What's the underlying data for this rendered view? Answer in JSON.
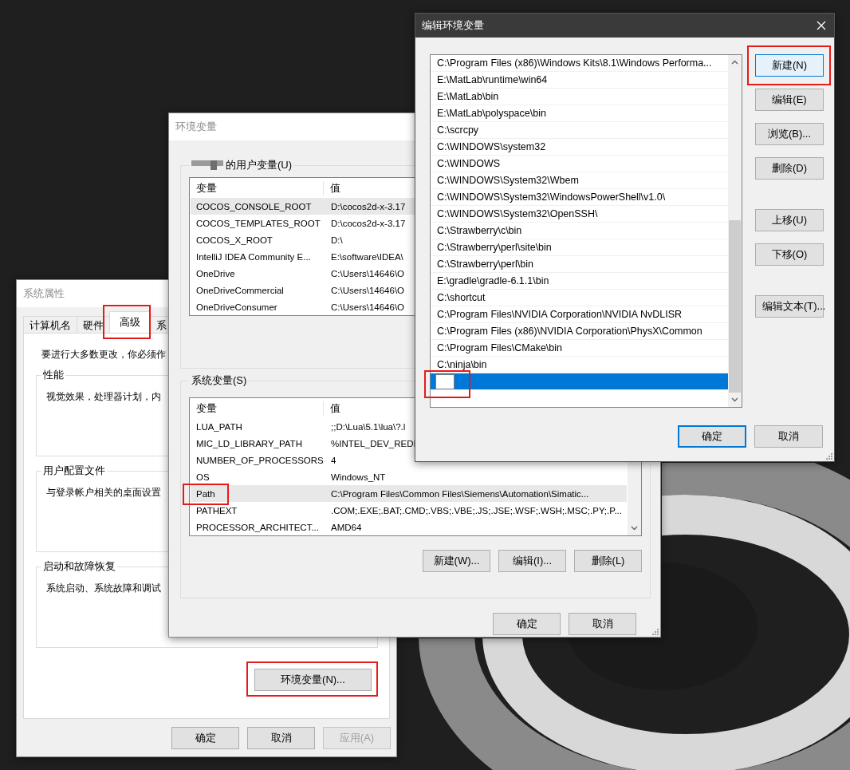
{
  "system_properties": {
    "title": "系统属性",
    "tabs": [
      {
        "label": "计算机名",
        "selected": false
      },
      {
        "label": "硬件",
        "selected": false
      },
      {
        "label": "高级",
        "selected": true
      },
      {
        "label": "系",
        "selected": false
      }
    ],
    "intro": "要进行大多数更改，你必须作",
    "groups": [
      {
        "title": "性能",
        "text": "视觉效果，处理器计划，内"
      },
      {
        "title": "用户配置文件",
        "text": "与登录帐户相关的桌面设置"
      },
      {
        "title": "启动和故障恢复",
        "text": "系统启动、系统故障和调试"
      }
    ],
    "env_button": "环境变量(N)...",
    "buttons": [
      {
        "label": "确定",
        "disabled": false
      },
      {
        "label": "取消",
        "disabled": false
      },
      {
        "label": "应用(A)",
        "disabled": true
      }
    ]
  },
  "environment_variables": {
    "title": "环境变量",
    "user_group": {
      "label": "的用户变量(U)",
      "columns": [
        "变量",
        "值"
      ],
      "rows": [
        {
          "name": "COCOS_CONSOLE_ROOT",
          "value": "D:\\cocos2d-x-3.17",
          "selected": true
        },
        {
          "name": "COCOS_TEMPLATES_ROOT",
          "value": "D:\\cocos2d-x-3.17",
          "selected": false
        },
        {
          "name": "COCOS_X_ROOT",
          "value": "D:\\",
          "selected": false
        },
        {
          "name": "IntelliJ IDEA Community E...",
          "value": "E:\\software\\IDEA\\",
          "selected": false
        },
        {
          "name": "OneDrive",
          "value": "C:\\Users\\14646\\O",
          "selected": false
        },
        {
          "name": "OneDriveCommercial",
          "value": "C:\\Users\\14646\\O",
          "selected": false
        },
        {
          "name": "OneDriveConsumer",
          "value": "C:\\Users\\14646\\O",
          "selected": false
        }
      ]
    },
    "system_group": {
      "label": "系统变量(S)",
      "columns": [
        "变量",
        "值"
      ],
      "rows": [
        {
          "name": "LUA_PATH",
          "value": ";;D:\\Lua\\5.1\\lua\\?.l",
          "selected": false
        },
        {
          "name": "MIC_LD_LIBRARY_PATH",
          "value": "%INTEL_DEV_REDI",
          "selected": false
        },
        {
          "name": "NUMBER_OF_PROCESSORS",
          "value": "4",
          "selected": false
        },
        {
          "name": "OS",
          "value": "Windows_NT",
          "selected": false
        },
        {
          "name": "Path",
          "value": "C:\\Program Files\\Common Files\\Siemens\\Automation\\Simatic...",
          "selected": true
        },
        {
          "name": "PATHEXT",
          "value": ".COM;.EXE;.BAT;.CMD;.VBS;.VBE;.JS;.JSE;.WSF;.WSH;.MSC;.PY;.P...",
          "selected": false
        },
        {
          "name": "PROCESSOR_ARCHITECT...",
          "value": "AMD64",
          "selected": false
        }
      ],
      "buttons": [
        "新建(W)...",
        "编辑(I)...",
        "删除(L)"
      ]
    },
    "buttons": [
      "确定",
      "取消"
    ]
  },
  "edit_dialog": {
    "title": "编辑环境变量",
    "entries": [
      {
        "kind": "text",
        "text": "C:\\Program Files (x86)\\Windows Kits\\8.1\\Windows Performa...",
        "selected": false
      },
      {
        "kind": "text",
        "text": "E:\\MatLab\\runtime\\win64",
        "selected": false
      },
      {
        "kind": "text",
        "text": "E:\\MatLab\\bin",
        "selected": false
      },
      {
        "kind": "text",
        "text": "E:\\MatLab\\polyspace\\bin",
        "selected": false
      },
      {
        "kind": "text",
        "text": "C:\\scrcpy",
        "selected": false
      },
      {
        "kind": "text",
        "text": "C:\\WINDOWS\\system32",
        "selected": false
      },
      {
        "kind": "text",
        "text": "C:\\WINDOWS",
        "selected": false
      },
      {
        "kind": "text",
        "text": "C:\\WINDOWS\\System32\\Wbem",
        "selected": false
      },
      {
        "kind": "text",
        "text": "C:\\WINDOWS\\System32\\WindowsPowerShell\\v1.0\\",
        "selected": false
      },
      {
        "kind": "text",
        "text": "C:\\WINDOWS\\System32\\OpenSSH\\",
        "selected": false
      },
      {
        "kind": "text",
        "text": "C:\\Strawberry\\c\\bin",
        "selected": false
      },
      {
        "kind": "text",
        "text": "C:\\Strawberry\\perl\\site\\bin",
        "selected": false
      },
      {
        "kind": "text",
        "text": "C:\\Strawberry\\perl\\bin",
        "selected": false
      },
      {
        "kind": "text",
        "text": "E:\\gradle\\gradle-6.1.1\\bin",
        "selected": false
      },
      {
        "kind": "text",
        "text": "C:\\shortcut",
        "selected": false
      },
      {
        "kind": "text",
        "text": "C:\\Program Files\\NVIDIA Corporation\\NVIDIA NvDLISR",
        "selected": false
      },
      {
        "kind": "text",
        "text": "C:\\Program Files (x86)\\NVIDIA Corporation\\PhysX\\Common",
        "selected": false
      },
      {
        "kind": "text",
        "text": "C:\\Program Files\\CMake\\bin",
        "selected": false
      },
      {
        "kind": "text",
        "text": "C:\\ninja\\bin",
        "selected": false
      },
      {
        "kind": "input",
        "selected": true
      }
    ],
    "side_buttons": [
      [
        {
          "label": "新建(N)",
          "focused": true
        },
        {
          "label": "编辑(E)",
          "focused": false
        },
        {
          "label": "浏览(B)...",
          "focused": false
        },
        {
          "label": "删除(D)",
          "focused": false
        }
      ],
      [
        {
          "label": "上移(U)",
          "focused": false
        },
        {
          "label": "下移(O)",
          "focused": false
        }
      ],
      [
        {
          "label": "编辑文本(T)...",
          "focused": false
        }
      ]
    ],
    "buttons": [
      {
        "label": "确定",
        "default": true
      },
      {
        "label": "取消",
        "default": false
      }
    ]
  }
}
